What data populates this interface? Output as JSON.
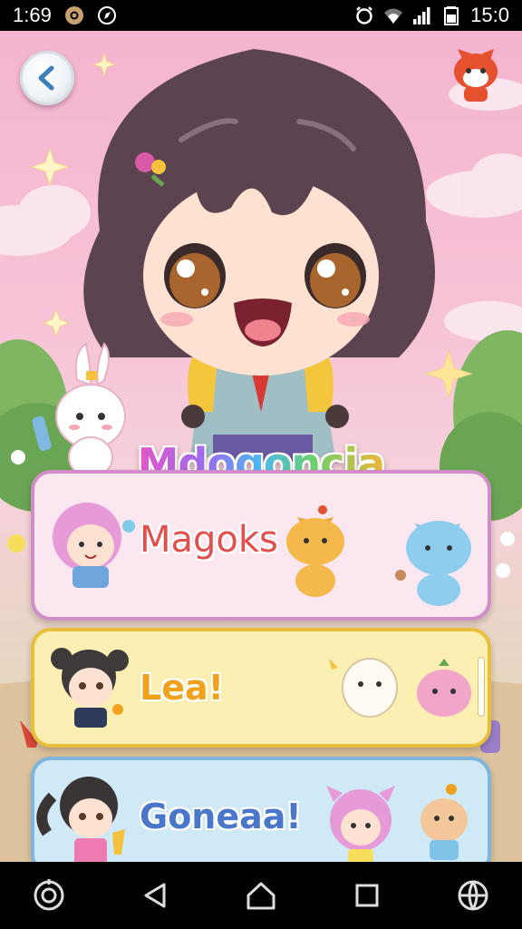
{
  "status_bar": {
    "time_left": "1:69",
    "time_right": "15:0",
    "icons": [
      "settings-circle-icon",
      "compass-icon",
      "alarm-icon",
      "wifi-icon",
      "signal-icon",
      "battery-icon"
    ]
  },
  "game": {
    "title": "Mdogoncia",
    "back_icon": "chevron-left-icon",
    "menu": [
      {
        "label": "Magoks",
        "color": "#e2504e"
      },
      {
        "label": "Lea!",
        "color": "#f0a21c"
      },
      {
        "label": "Goneaa!",
        "color": "#4a77c9"
      }
    ]
  },
  "nav_bar": {
    "icons": [
      "assistant-icon",
      "back-triangle-icon",
      "home-icon",
      "recents-square-icon",
      "globe-icon"
    ]
  },
  "colors": {
    "sky_pink": "#f4b4cf",
    "card1_bg": "#fbe7f0",
    "card2_bg": "#fbefb4",
    "card3_bg": "#cfe9f7"
  }
}
